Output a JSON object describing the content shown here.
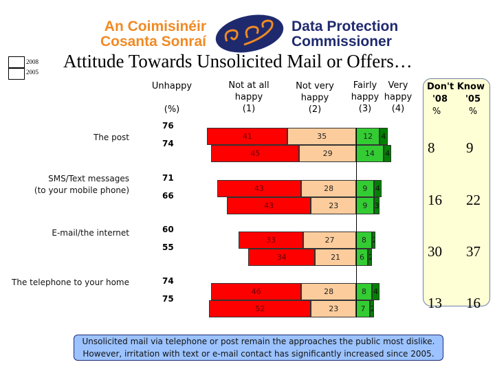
{
  "logo": {
    "irish_line1": "An Coimisinéir",
    "irish_line2": "Cosanta Sonraí",
    "english_line1": "Data Protection",
    "english_line2": "Commissioner"
  },
  "title": "Attitude Towards Unsolicited Mail or Offers…",
  "legend": {
    "year1": "2008",
    "year2": "2005"
  },
  "headers": {
    "unhappy": "Unhappy",
    "pct": "(%)",
    "not_at_all": "Not at all happy",
    "not_at_all_code": "(1)",
    "not_very": "Not very happy",
    "not_very_code": "(2)",
    "fairly": "Fairly happy",
    "fairly_code": "(3)",
    "very": "Very happy",
    "very_code": "(4)",
    "dont_know": "Don't Know",
    "y08": "'08",
    "y05": "'05",
    "dk_pct08": "%",
    "dk_pct05": "%"
  },
  "colors": {
    "not_at_all": "#ff0000",
    "not_very": "#fccc9c",
    "fairly": "#33cc33",
    "very": "#008000"
  },
  "note": {
    "line1": "Unsolicited mail via telephone or post remain the approaches the public most dislike.",
    "line2": "However, irritation with text or e-mail contact has significantly increased since 2005."
  },
  "chart_data": {
    "type": "bar",
    "stacked": "diverging",
    "categories": [
      "The post",
      "SMS/Text messages (to your mobile phone)",
      "E-mail/the internet",
      "The telephone to your home"
    ],
    "rows": [
      {
        "category": "The post",
        "unhappy": [
          76,
          74
        ],
        "y2008": [
          41,
          35,
          12,
          4
        ],
        "y2005": [
          45,
          29,
          14,
          4
        ],
        "dont_know": [
          8,
          9
        ]
      },
      {
        "category": "SMS/Text messages (to your mobile phone)",
        "unhappy": [
          71,
          66
        ],
        "y2008": [
          43,
          28,
          9,
          4
        ],
        "y2005": [
          43,
          23,
          9,
          3
        ],
        "dont_know": [
          16,
          22
        ]
      },
      {
        "category": "E-mail/the internet",
        "unhappy": [
          60,
          55
        ],
        "y2008": [
          33,
          27,
          8,
          2
        ],
        "y2005": [
          34,
          21,
          6,
          2
        ],
        "dont_know": [
          30,
          37
        ]
      },
      {
        "category": "The telephone to your home",
        "unhappy": [
          74,
          75
        ],
        "y2008": [
          46,
          28,
          8,
          4
        ],
        "y2005": [
          52,
          23,
          7,
          2
        ],
        "dont_know": [
          13,
          16
        ]
      }
    ],
    "series": [
      {
        "name": "Not at all happy (1)"
      },
      {
        "name": "Not very happy (2)"
      },
      {
        "name": "Fairly happy (3)"
      },
      {
        "name": "Very happy (4)"
      }
    ]
  }
}
